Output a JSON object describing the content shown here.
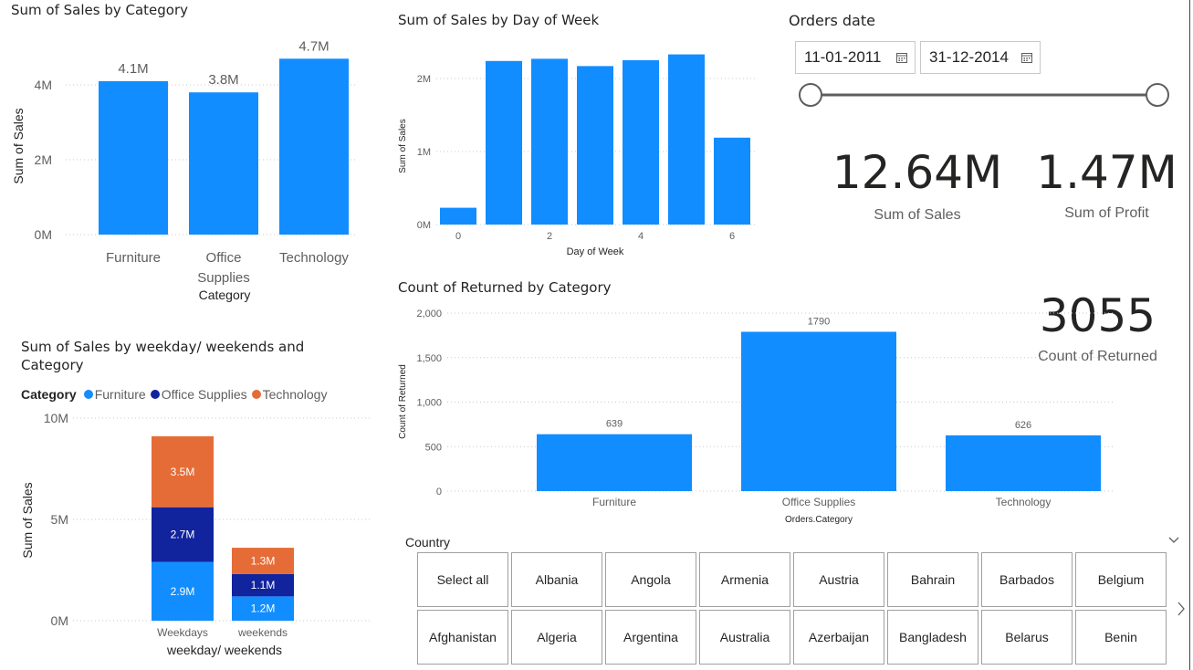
{
  "charts": {
    "sales_by_category": {
      "title": "Sum of Sales by Category",
      "xlabel": "Category",
      "ylabel": "Sum of Sales",
      "y_ticks": [
        "0M",
        "2M",
        "4M"
      ],
      "category_labels": [
        [
          "Furniture"
        ],
        [
          "Office",
          "Supplies"
        ],
        [
          "Technology"
        ]
      ],
      "data_labels": [
        "4.1M",
        "3.8M",
        "4.7M"
      ]
    },
    "sales_by_day": {
      "title": "Sum of Sales by Day of Week",
      "xlabel": "Day of Week",
      "ylabel": "Sum of Sales",
      "y_ticks": [
        "0M",
        "1M",
        "2M"
      ],
      "x_ticks": [
        "0",
        "2",
        "4",
        "6"
      ]
    },
    "weekday_weekends": {
      "title_line1": "Sum of Sales by weekday/ weekends and",
      "title_line2": "Category",
      "legend_title": "Category",
      "xlabel": "weekday/ weekends",
      "ylabel": "Sum of Sales",
      "y_ticks": [
        "0M",
        "5M",
        "10M"
      ]
    },
    "returned_by_category": {
      "title": "Count of Returned by Category",
      "xlabel": "Orders.Category",
      "ylabel": "Count of Returned",
      "y_ticks": [
        "0",
        "500",
        "1,000",
        "1,500",
        "2,000"
      ]
    }
  },
  "chart_data": [
    {
      "type": "bar",
      "title": "Sum of Sales by Category",
      "xlabel": "Category",
      "ylabel": "Sum of Sales",
      "categories": [
        "Furniture",
        "Office Supplies",
        "Technology"
      ],
      "values": [
        4.1,
        3.8,
        4.7
      ],
      "unit": "M",
      "ylim": [
        0,
        4.9
      ]
    },
    {
      "type": "bar",
      "title": "Sum of Sales by Day of Week",
      "xlabel": "Day of Week",
      "ylabel": "Sum of Sales",
      "categories": [
        0,
        1,
        2,
        3,
        4,
        5,
        6
      ],
      "values": [
        0.23,
        2.24,
        2.27,
        2.17,
        2.25,
        2.33,
        1.19
      ],
      "unit": "M",
      "ylim": [
        0,
        2.4
      ]
    },
    {
      "type": "bar",
      "stacked": true,
      "title": "Sum of Sales by weekday/ weekends and Category",
      "xlabel": "weekday/ weekends",
      "ylabel": "Sum of Sales",
      "categories": [
        "Weekdays",
        "weekends"
      ],
      "series": [
        {
          "name": "Furniture",
          "values": [
            2.9,
            1.2
          ],
          "labels": [
            "2.9M",
            "1.2M"
          ],
          "color": "#118dff"
        },
        {
          "name": "Office Supplies",
          "values": [
            2.7,
            1.1
          ],
          "labels": [
            "2.7M",
            "1.1M"
          ],
          "color": "#12239e"
        },
        {
          "name": "Technology",
          "values": [
            3.5,
            1.3
          ],
          "labels": [
            "3.5M",
            "1.3M"
          ],
          "color": "#e66c37"
        }
      ],
      "ylim": [
        0,
        10
      ]
    },
    {
      "type": "bar",
      "title": "Count of Returned by Category",
      "xlabel": "Orders.Category",
      "ylabel": "Count of Returned",
      "categories": [
        "Furniture",
        "Office Supplies",
        "Technology"
      ],
      "values": [
        639,
        1790,
        626
      ],
      "ylim": [
        0,
        2000
      ]
    }
  ],
  "date_slicer": {
    "title": "Orders date",
    "start": "11-01-2011",
    "end": "31-12-2014"
  },
  "kpis": {
    "sales": {
      "value": "12.64M",
      "label": "Sum of Sales"
    },
    "profit": {
      "value": "1.47M",
      "label": "Sum of Profit"
    },
    "returned": {
      "value": "3055",
      "label": "Count of Returned"
    }
  },
  "country_slicer": {
    "title": "Country",
    "tiles": [
      "Select all",
      "Albania",
      "Angola",
      "Armenia",
      "Austria",
      "Bahrain",
      "Barbados",
      "Belgium",
      "Afghanistan",
      "Algeria",
      "Argentina",
      "Australia",
      "Azerbaijan",
      "Bangladesh",
      "Belarus",
      "Benin"
    ]
  },
  "colors": {
    "bar": "#118dff",
    "furniture": "#118dff",
    "office_supplies": "#12239e",
    "technology": "#e66c37",
    "grid": "#c8c8c8",
    "axis_text": "#605e5c"
  }
}
